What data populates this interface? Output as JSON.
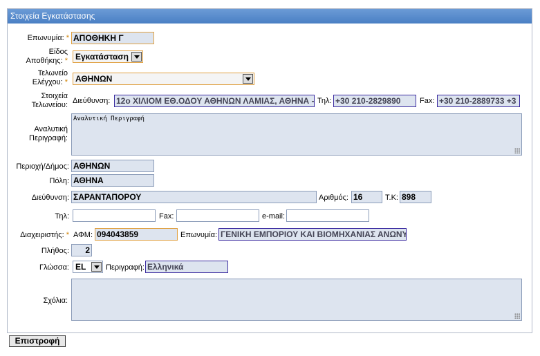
{
  "panel": {
    "title": "Στοιχεία Εγκατάστασης"
  },
  "form": {
    "eponymia": {
      "label": "Επωνυμία:",
      "value": "ΑΠΟΘΗΚΗ Γ"
    },
    "eidos": {
      "label_line1": "Είδος",
      "label_line2": "Αποθήκης:",
      "value": "Εγκατάσταση"
    },
    "teloneio": {
      "label_line1": "Τελωνείο",
      "label_line2": "Ελέγχου:",
      "value": "ΑΘΗΝΩΝ"
    },
    "stoixeia": {
      "label_line1": "Στοιχεία",
      "label_line2": "Τελωνείου:",
      "address_label": "Διεύθυνση:",
      "address_value": "12ο ΧΙΛΙΟΜ ΕΘ.ΟΔΟΥ ΑΘΗΝΩΝ ΛΑΜΙΑΣ, ΑΘΗΝΑ -",
      "phone_label": "Τηλ:",
      "phone_value": "+30 210-2829890",
      "fax_label": "Fax:",
      "fax_value": "+30 210-2889733 +3"
    },
    "perigrafi": {
      "label_line1": "Αναλυτική",
      "label_line2": "Περιγραφή:",
      "value": "Αναλυτική Περιγραφή"
    },
    "perioxi": {
      "label": "Περιοχή/Δήμος:",
      "value": "ΑΘΗΝΩΝ"
    },
    "poli": {
      "label": "Πόλη:",
      "value": "ΑΘΗΝΑ"
    },
    "dieythynsi": {
      "label": "Διεύθυνση:",
      "value": "ΣΑΡΑΝΤΑΠΟΡΟΥ",
      "number_label": "Αριθμός:",
      "number_value": "16",
      "tk_label": "Τ.Κ:",
      "tk_value": "898"
    },
    "contact": {
      "phone_label": "Τηλ:",
      "phone_value": "",
      "fax_label": "Fax:",
      "fax_value": "",
      "email_label": "e-mail:",
      "email_value": ""
    },
    "diaxeiristis": {
      "label": "Διαχειριστής:",
      "afm_label": "ΑΦΜ:",
      "afm_value": "094043859",
      "name_label": "Επωνυμία:",
      "name_value": "ΓΕΝΙΚΗ ΕΜΠΟΡΙΟΥ ΚΑΙ ΒΙΟΜΗΧΑΝΙΑΣ ΑΝΩΝΥ"
    },
    "plithos": {
      "label": "Πλήθος:",
      "value": "2"
    },
    "glossa": {
      "label": "Γλώσσα:",
      "value": "EL",
      "desc_label": "Περιγραφή:",
      "desc_value": "Ελληνικά"
    },
    "sxolia": {
      "label": "Σχόλια:",
      "value": ""
    }
  },
  "buttons": {
    "back": "Επιστροφή"
  },
  "colors": {
    "title_bar": "#4a7fc4",
    "required_star": "#d08000",
    "field_bg": "#dde4ef"
  }
}
